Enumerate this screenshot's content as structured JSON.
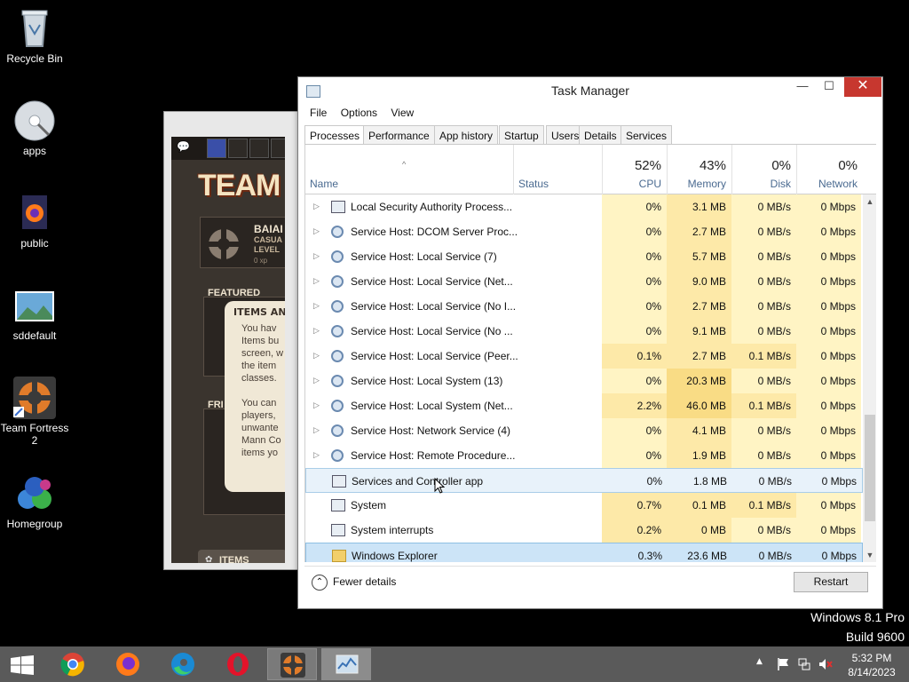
{
  "desktop": {
    "icons": [
      {
        "label": "Recycle Bin"
      },
      {
        "label": "apps"
      },
      {
        "label": "public"
      },
      {
        "label": "sddefault"
      },
      {
        "label": "Team Fortress 2"
      },
      {
        "label": "Homegroup"
      }
    ]
  },
  "game_window": {
    "logo": "TEAM FO",
    "player_name": "BAIAI",
    "player_sub": "CASUA",
    "player_level": "LEVEL",
    "xp": "0 xp",
    "featured_label": "FEATURED",
    "friends_label": "FRI",
    "bubble_title": "ITEMS AN",
    "bubble_para1": "You hav\nItems bu\nscreen, w\nthe item\nclasses.",
    "bubble_para2": "You can\nplayers,\nunwante\nMann Co\nitems yo",
    "items_button": "ITEMS"
  },
  "task_manager": {
    "title": "Task Manager",
    "menu": [
      "File",
      "Options",
      "View"
    ],
    "tabs": [
      "Processes",
      "Performance",
      "App history",
      "Startup",
      "Users",
      "Details",
      "Services"
    ],
    "active_tab": "Processes",
    "columns": {
      "name": "Name",
      "status": "Status",
      "cpu": {
        "pct": "52%",
        "label": "CPU"
      },
      "memory": {
        "pct": "43%",
        "label": "Memory"
      },
      "disk": {
        "pct": "0%",
        "label": "Disk"
      },
      "network": {
        "pct": "0%",
        "label": "Network"
      }
    },
    "rows": [
      {
        "name": "Local Security Authority Process...",
        "expandable": true,
        "icon": "window",
        "cpu": "0%",
        "mem": "3.1 MB",
        "disk": "0 MB/s",
        "net": "0 Mbps"
      },
      {
        "name": "Service Host: DCOM Server Proc...",
        "expandable": true,
        "icon": "gear",
        "cpu": "0%",
        "mem": "2.7 MB",
        "disk": "0 MB/s",
        "net": "0 Mbps"
      },
      {
        "name": "Service Host: Local Service (7)",
        "expandable": true,
        "icon": "gear",
        "cpu": "0%",
        "mem": "5.7 MB",
        "disk": "0 MB/s",
        "net": "0 Mbps"
      },
      {
        "name": "Service Host: Local Service (Net...",
        "expandable": true,
        "icon": "gear",
        "cpu": "0%",
        "mem": "9.0 MB",
        "disk": "0 MB/s",
        "net": "0 Mbps"
      },
      {
        "name": "Service Host: Local Service (No I...",
        "expandable": true,
        "icon": "gear",
        "cpu": "0%",
        "mem": "2.7 MB",
        "disk": "0 MB/s",
        "net": "0 Mbps"
      },
      {
        "name": "Service Host: Local Service (No ...",
        "expandable": true,
        "icon": "gear",
        "cpu": "0%",
        "mem": "9.1 MB",
        "disk": "0 MB/s",
        "net": "0 Mbps"
      },
      {
        "name": "Service Host: Local Service (Peer...",
        "expandable": true,
        "icon": "gear",
        "cpu": "0.1%",
        "mem": "2.7 MB",
        "disk": "0.1 MB/s",
        "net": "0 Mbps"
      },
      {
        "name": "Service Host: Local System (13)",
        "expandable": true,
        "icon": "gear",
        "cpu": "0%",
        "mem": "20.3 MB",
        "disk": "0 MB/s",
        "net": "0 Mbps"
      },
      {
        "name": "Service Host: Local System (Net...",
        "expandable": true,
        "icon": "gear",
        "cpu": "2.2%",
        "mem": "46.0 MB",
        "disk": "0.1 MB/s",
        "net": "0 Mbps"
      },
      {
        "name": "Service Host: Network Service (4)",
        "expandable": true,
        "icon": "gear",
        "cpu": "0%",
        "mem": "4.1 MB",
        "disk": "0 MB/s",
        "net": "0 Mbps"
      },
      {
        "name": "Service Host: Remote Procedure...",
        "expandable": true,
        "icon": "gear",
        "cpu": "0%",
        "mem": "1.9 MB",
        "disk": "0 MB/s",
        "net": "0 Mbps"
      },
      {
        "name": "Services and Controller app",
        "expandable": false,
        "icon": "window",
        "cpu": "0%",
        "mem": "1.8 MB",
        "disk": "0 MB/s",
        "net": "0 Mbps",
        "state": "hover"
      },
      {
        "name": "System",
        "expandable": false,
        "icon": "window",
        "cpu": "0.7%",
        "mem": "0.1 MB",
        "disk": "0.1 MB/s",
        "net": "0 Mbps"
      },
      {
        "name": "System interrupts",
        "expandable": false,
        "icon": "window",
        "cpu": "0.2%",
        "mem": "0 MB",
        "disk": "0 MB/s",
        "net": "0 Mbps"
      },
      {
        "name": "Windows Explorer",
        "expandable": false,
        "icon": "folder",
        "cpu": "0.3%",
        "mem": "23.6 MB",
        "disk": "0 MB/s",
        "net": "0 Mbps",
        "state": "selected"
      }
    ],
    "fewer_details": "Fewer details",
    "restart_button": "Restart"
  },
  "watermark": {
    "line1": "Windows 8.1 Pro",
    "line2": "Build 9600"
  },
  "taskbar": {
    "apps": [
      "start",
      "chrome",
      "firefox",
      "edge",
      "opera",
      "team-fortress-2",
      "task-manager"
    ],
    "clock_time": "5:32 PM",
    "clock_date": "8/14/2023"
  },
  "colors": {
    "cpu_heat": "#fff4c4",
    "mem_heat": "#fde9a8",
    "selected_row": "#cce4f7",
    "close_button": "#c7372f"
  }
}
